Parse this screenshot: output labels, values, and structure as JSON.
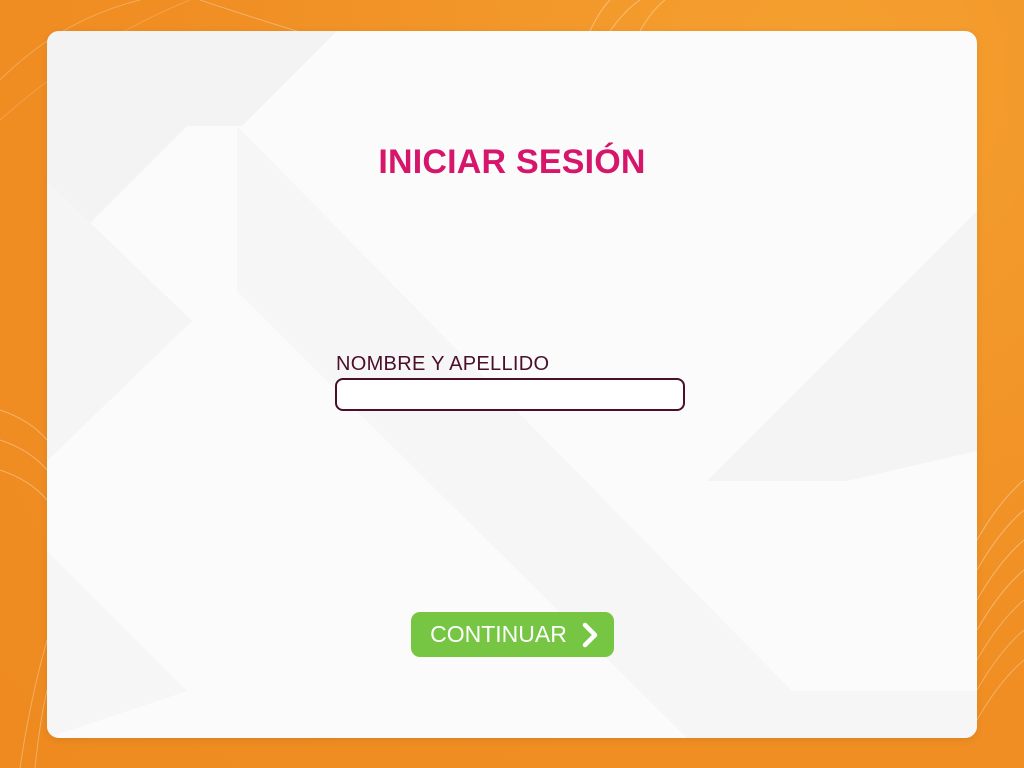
{
  "login": {
    "title": "INICIAR SESIÓN",
    "name_label": "NOMBRE Y APELLIDO",
    "name_value": "",
    "name_placeholder": "",
    "continue_label": "CONTINUAR"
  },
  "icons": {
    "continue_icon": "chevron-right-icon"
  },
  "colors": {
    "background": "#f29422",
    "card": "#fbfbfb",
    "title": "#d6166b",
    "label": "#4a0f2a",
    "input_border": "#4a0f2a",
    "button": "#76c643",
    "button_text": "#ffffff"
  }
}
